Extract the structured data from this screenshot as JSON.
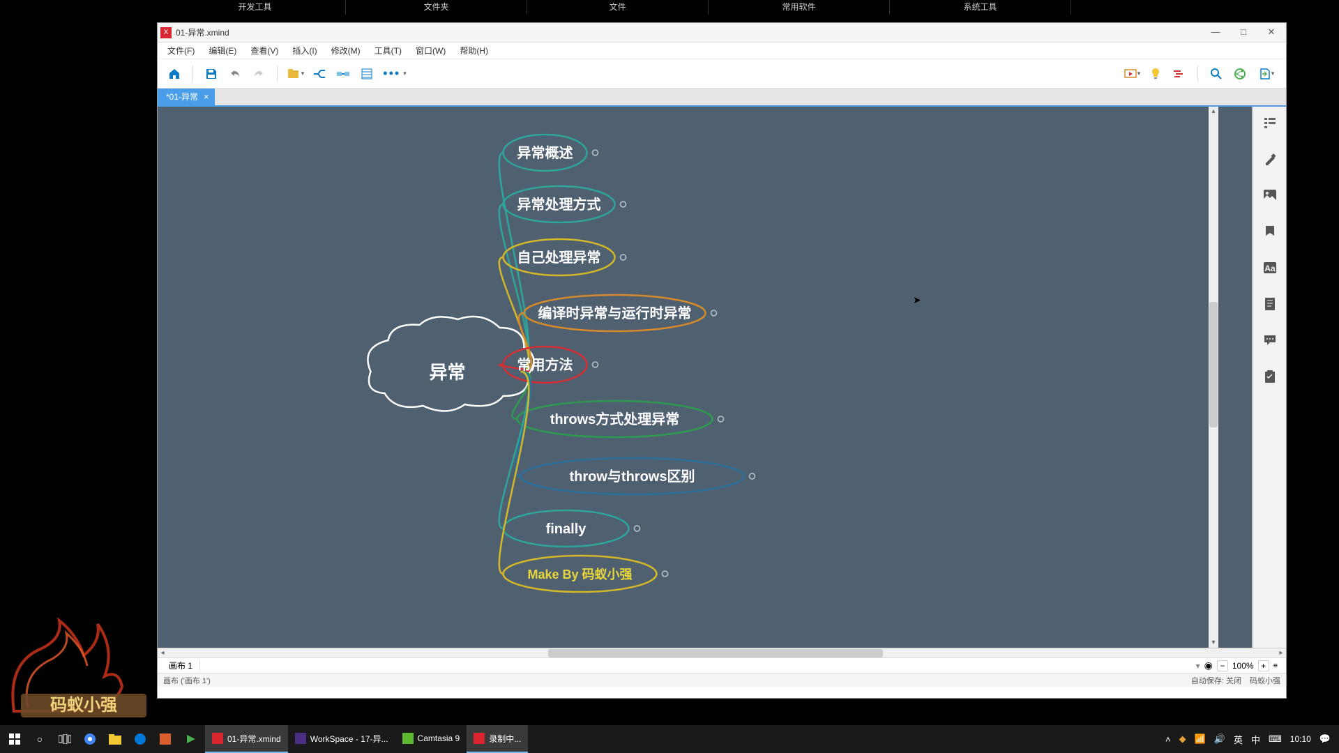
{
  "desktop_tabs": [
    "开发工具",
    "文件夹",
    "文件",
    "常用软件",
    "系统工具"
  ],
  "titlebar": {
    "title": "01-异常.xmind"
  },
  "window_controls": {
    "min": "—",
    "max": "□",
    "close": "✕"
  },
  "menubar": [
    "文件(F)",
    "编辑(E)",
    "查看(V)",
    "插入(I)",
    "修改(M)",
    "工具(T)",
    "窗口(W)",
    "帮助(H)"
  ],
  "doc_tab": {
    "name": "*01-异常",
    "close": "×"
  },
  "mindmap": {
    "central": "异常",
    "nodes": [
      {
        "text": "异常概述",
        "color": "#2ea59b"
      },
      {
        "text": "异常处理方式",
        "color": "#2ea59b"
      },
      {
        "text": "自己处理异常",
        "color": "#d4b828"
      },
      {
        "text": "编译时异常与运行时异常",
        "color": "#d68a2a"
      },
      {
        "text": "常用方法",
        "color": "#d62e33"
      },
      {
        "text": "throws方式处理异常",
        "color": "#2e9b4e"
      },
      {
        "text": "throw与throws区别",
        "color": "#2b6f9b"
      },
      {
        "text": "finally",
        "color": "#2ea59b"
      },
      {
        "text": "Make By 码蚁小强",
        "color": "#d4b828",
        "yellow": true
      }
    ]
  },
  "bottombar": {
    "sheet": "画布 1",
    "zoom": "100%"
  },
  "statusbar": {
    "left": "画布 ('画布 1')",
    "autosave": "自动保存: 关闭",
    "brand": "码蚁小强"
  },
  "taskbar": {
    "items": [
      {
        "label": "01-异常.xmind",
        "color": "#d9262e",
        "active": true
      },
      {
        "label": "WorkSpace - 17-异...",
        "color": "#4b2e83"
      },
      {
        "label": "Camtasia 9",
        "color": "#5cb82e"
      },
      {
        "label": "录制中...",
        "color": "#d9262e",
        "active": true
      }
    ],
    "tray": {
      "ime1": "英",
      "ime2": "中",
      "time": "10:10"
    }
  }
}
